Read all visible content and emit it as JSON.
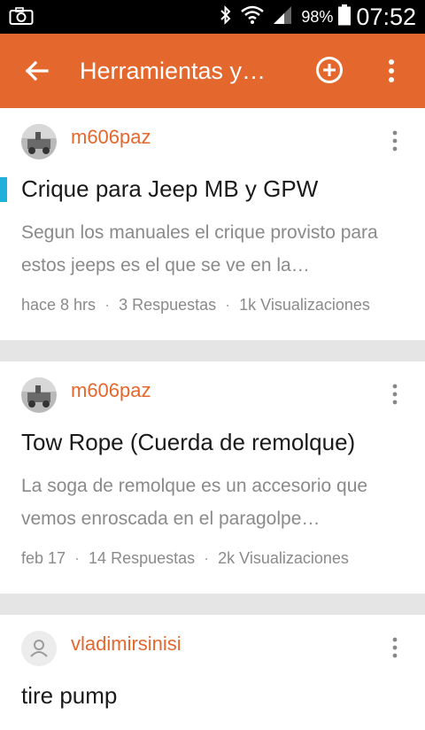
{
  "status_bar": {
    "battery_percent": "98%",
    "time": "07:52",
    "icons": [
      "camera-icon",
      "bluetooth-icon",
      "wifi-icon",
      "signal-icon",
      "battery-icon"
    ]
  },
  "app_bar": {
    "title": "Herramientas y…",
    "background": "#e4672e",
    "icons": [
      "back-arrow-icon",
      "add-circle-icon",
      "more-vert-icon"
    ]
  },
  "posts": [
    {
      "author": "m606paz",
      "title": "Crique para Jeep MB y GPW",
      "excerpt": "Segun los manuales el crique provisto para estos jeeps es el que se ve en la…",
      "time": "hace 8 hrs",
      "replies": "3 Respuestas",
      "views": "1k Visualizaciones",
      "unread": true
    },
    {
      "author": "m606paz",
      "title": "Tow Rope (Cuerda de remolque)",
      "excerpt": "La soga de remolque es un accesorio que vemos enroscada en el paragolpe…",
      "time": "feb 17",
      "replies": "14 Respuestas",
      "views": "2k Visualizaciones",
      "unread": false
    },
    {
      "author": "vladimirsinisi",
      "title": "tire pump",
      "excerpt": "",
      "time": "",
      "replies": "",
      "views": "",
      "unread": false
    }
  ],
  "colors": {
    "accent": "#e4672e",
    "unread_marker": "#20b0dc",
    "divider": "#e5e5e5"
  }
}
